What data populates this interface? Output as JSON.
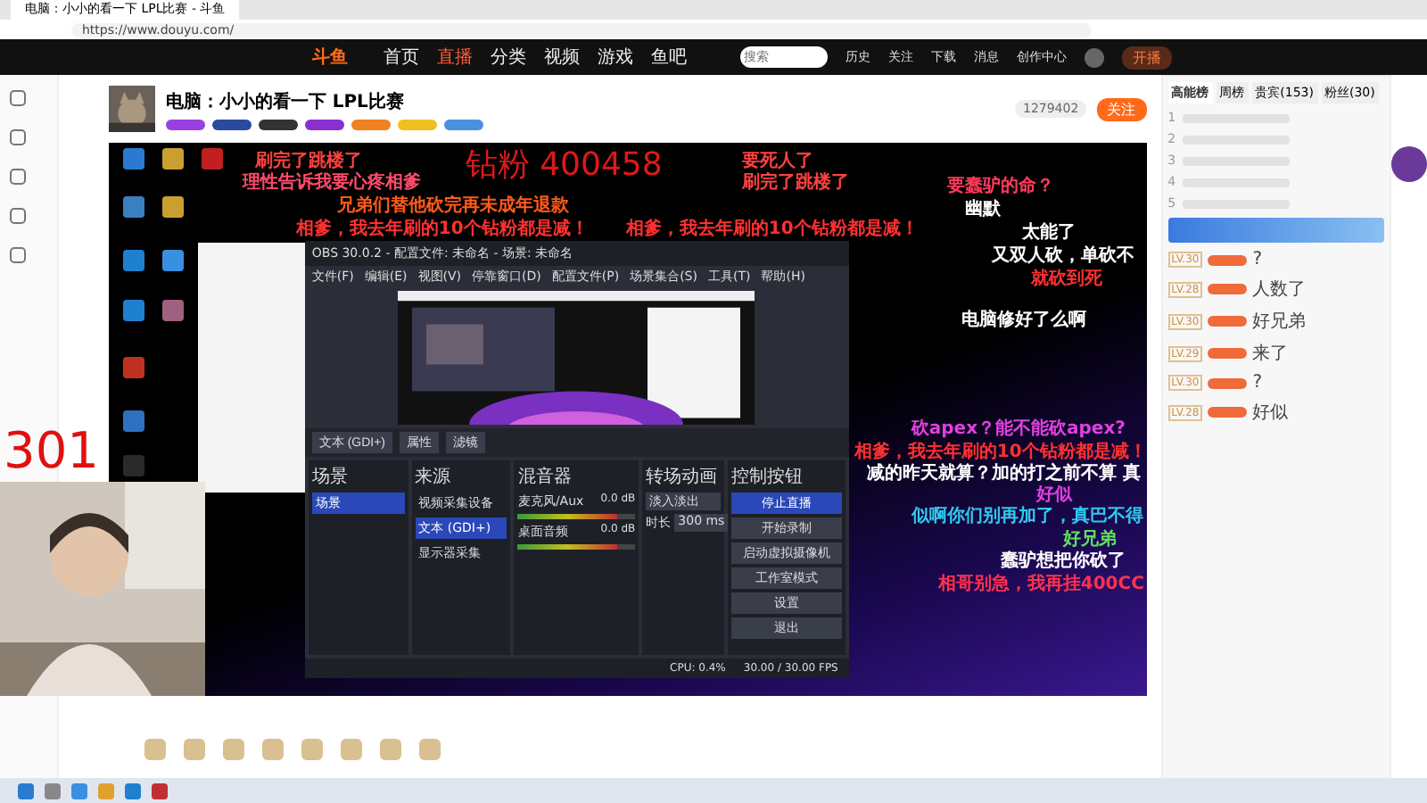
{
  "browser": {
    "tab_title": "电脑：小小的看一下 LPL比赛 - 斗鱼",
    "url": "https://www.douyu.com/"
  },
  "header": {
    "logo": "斗鱼",
    "nav": [
      {
        "label": "首页",
        "selected": false
      },
      {
        "label": "直播",
        "selected": true
      },
      {
        "label": "分类",
        "selected": false
      },
      {
        "label": "视频",
        "selected": false
      },
      {
        "label": "游戏",
        "selected": false
      },
      {
        "label": "鱼吧",
        "selected": false
      }
    ],
    "search_placeholder": "搜索",
    "actions": [
      "历史",
      "关注",
      "下载",
      "消息",
      "创作中心"
    ],
    "broadcast_button": "开播"
  },
  "room": {
    "title": "电脑：小小的看一下 LPL比赛",
    "followers": "1279402",
    "follow_button": "关注"
  },
  "danmaku": [
    {
      "text": "刷完了跳楼了",
      "color": "#ff4040"
    },
    {
      "text": "钻粉 400458",
      "color": "#e01818",
      "kind": "big"
    },
    {
      "text": "要死人了",
      "color": "#ff4040"
    },
    {
      "text": "理性告诉我要心疼相爹",
      "color": "#ff4a6a"
    },
    {
      "text": "刷完了跳楼了",
      "color": "#ff4040"
    },
    {
      "text": "兄弟们替他砍完再未成年退款",
      "color": "#ff5a1a"
    },
    {
      "text": "相爹，我去年刷的10个钻粉都是减！",
      "color": "#ff3030"
    },
    {
      "text": "相爹，我去年刷的10个钻粉都是减！",
      "color": "#ff3030"
    },
    {
      "text": "要蠢驴的命？",
      "color": "#ff3a5a"
    },
    {
      "text": "幽默",
      "color": "#ffffff"
    },
    {
      "text": "太能了",
      "color": "#ffffff"
    },
    {
      "text": "又双人砍，单砍不",
      "color": "#ffffff"
    },
    {
      "text": "就砍到死",
      "color": "#ff3030"
    },
    {
      "text": "电脑修好了么啊",
      "color": "#ffffff"
    },
    {
      "text": "砍apex？能不能砍apex?",
      "color": "#e040e0"
    },
    {
      "text": "相爹，我去年刷的10个钻粉都是减！",
      "color": "#ff3030"
    },
    {
      "text": "减的昨天就算？加的打之前不算 真",
      "color": "#ffffff"
    },
    {
      "text": "好似",
      "color": "#e040e0"
    },
    {
      "text": "似啊你们别再加了，真巴不得",
      "color": "#30c8f0"
    },
    {
      "text": "好兄弟",
      "color": "#60e060"
    },
    {
      "text": "蠢驴想把你砍了",
      "color": "#ffffff"
    },
    {
      "text": "相哥别急，我再挂400CC",
      "color": "#ff3050"
    }
  ],
  "overlay_number": "301",
  "obs": {
    "title": "OBS 30.0.2 - 配置文件: 未命名 - 场景: 未命名",
    "menu": [
      "文件(F)",
      "编辑(E)",
      "视图(V)",
      "停靠窗口(D)",
      "配置文件(P)",
      "场景集合(S)",
      "工具(T)",
      "帮助(H)"
    ],
    "toolbar": [
      "文本 (GDI+)",
      "属性",
      "滤镜"
    ],
    "docks": [
      "场景",
      "来源",
      "混音器",
      "转场动画",
      "控制按钮"
    ],
    "scenes": [
      {
        "label": "场景",
        "selected": true
      }
    ],
    "sources": [
      {
        "label": "视频采集设备",
        "selected": false
      },
      {
        "label": "文本 (GDI+)",
        "selected": true
      },
      {
        "label": "显示器采集",
        "selected": false
      }
    ],
    "mixer": [
      {
        "name": "麦克风/Aux",
        "reading": "0.0 dB",
        "level": 0.85
      },
      {
        "name": "桌面音频",
        "reading": "0.0 dB",
        "level": 0.85
      }
    ],
    "transition": {
      "value": "淡入淡出",
      "label": "时长",
      "duration": "300 ms"
    },
    "controls": [
      {
        "label": "停止直播",
        "selected": true
      },
      {
        "label": "开始录制",
        "selected": false
      },
      {
        "label": "启动虚拟摄像机",
        "selected": false
      },
      {
        "label": "工作室模式",
        "selected": false
      },
      {
        "label": "设置",
        "selected": false
      },
      {
        "label": "退出",
        "selected": false
      }
    ],
    "status": [
      "CPU: 0.4%",
      "30.00 / 30.00 FPS"
    ]
  },
  "chat": {
    "tabs": [
      {
        "label": "高能榜",
        "selected": true
      },
      {
        "label": "周榜",
        "selected": false
      },
      {
        "label": "贵宾(153)",
        "selected": false
      },
      {
        "label": "粉丝(30)",
        "selected": false
      }
    ],
    "ranks": [
      "1",
      "2",
      "3",
      "4",
      "5"
    ],
    "messages": [
      {
        "level": "LV.30",
        "text": "?"
      },
      {
        "level": "LV.28",
        "text": "人数了"
      },
      {
        "level": "LV.30",
        "text": "好兄弟"
      },
      {
        "level": "LV.29",
        "text": "来了"
      },
      {
        "level": "LV.30",
        "text": "?"
      },
      {
        "level": "LV.28",
        "text": "好似"
      }
    ]
  }
}
